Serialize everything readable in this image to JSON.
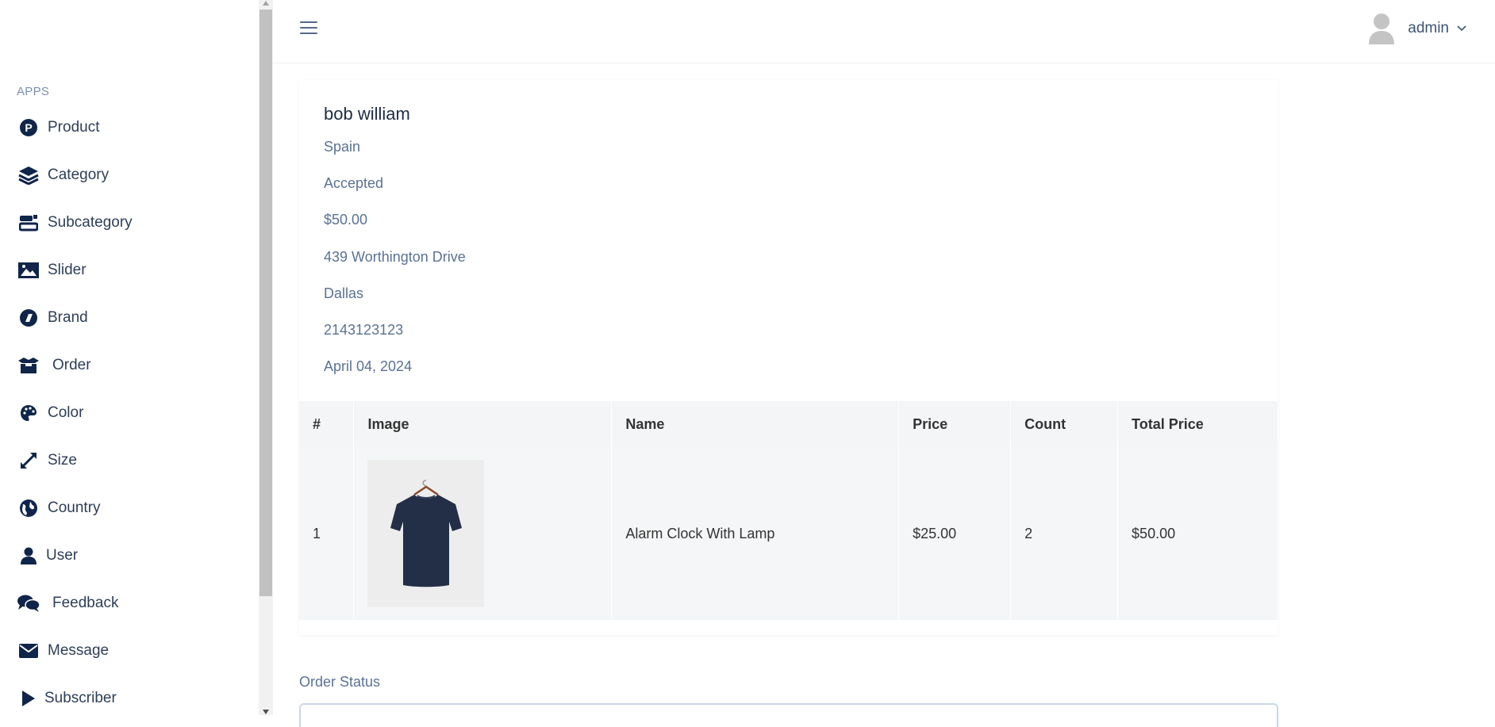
{
  "sidebar": {
    "section_label": "APPS",
    "items": [
      {
        "label": "Product",
        "icon": "product-icon"
      },
      {
        "label": "Category",
        "icon": "layers-icon"
      },
      {
        "label": "Subcategory",
        "icon": "subcategory-icon"
      },
      {
        "label": "Slider",
        "icon": "image-icon"
      },
      {
        "label": "Brand",
        "icon": "brand-icon"
      },
      {
        "label": "Order",
        "icon": "box-icon"
      },
      {
        "label": "Color",
        "icon": "palette-icon"
      },
      {
        "label": "Size",
        "icon": "expand-icon"
      },
      {
        "label": "Country",
        "icon": "globe-icon"
      },
      {
        "label": "User",
        "icon": "user-icon"
      },
      {
        "label": "Feedback",
        "icon": "comments-icon"
      },
      {
        "label": "Message",
        "icon": "envelope-icon"
      },
      {
        "label": "Subscriber",
        "icon": "play-icon"
      }
    ]
  },
  "header": {
    "user_name": "admin"
  },
  "order": {
    "customer_name": "bob william",
    "country": "Spain",
    "status": "Accepted",
    "total": "$50.00",
    "address": "439 Worthington Drive",
    "city": "Dallas",
    "phone": "2143123123",
    "date": "April 04, 2024"
  },
  "table": {
    "headers": [
      "#",
      "Image",
      "Name",
      "Price",
      "Count",
      "Total Price"
    ],
    "rows": [
      {
        "index": "1",
        "name": "Alarm Clock With Lamp",
        "price": "$25.00",
        "count": "2",
        "total": "$50.00"
      }
    ]
  },
  "order_status": {
    "label": "Order Status"
  },
  "colors": {
    "nav_icon": "#0f2549",
    "nav_text": "#2e3e57",
    "info_text": "#5a7293"
  }
}
